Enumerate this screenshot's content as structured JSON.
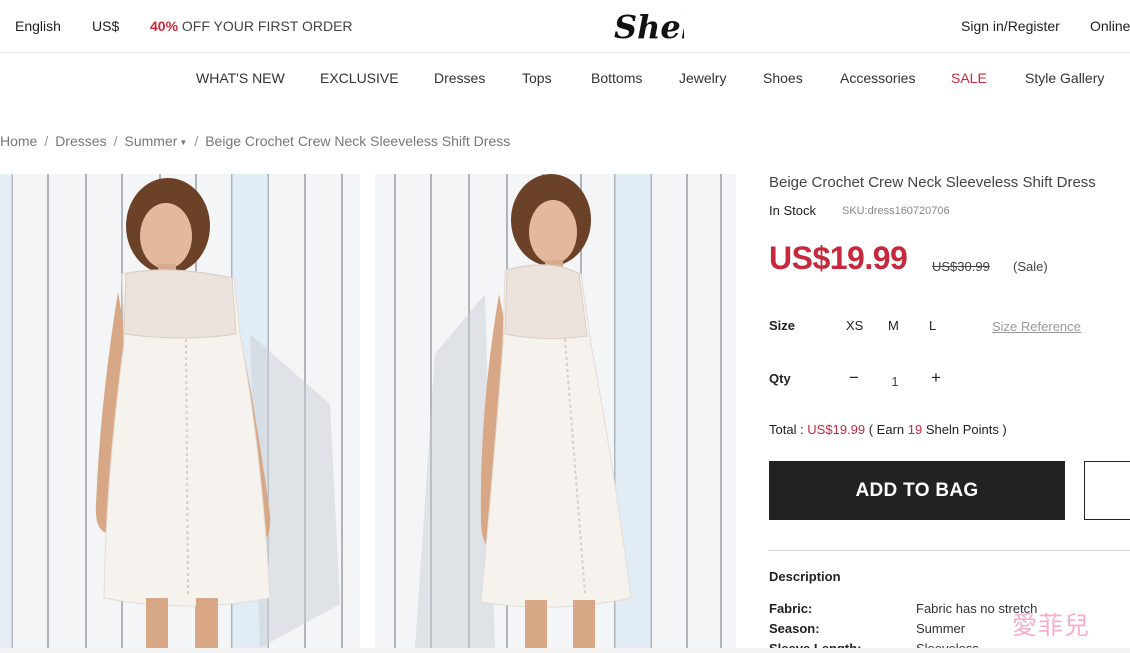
{
  "topbar": {
    "language": "English",
    "currency": "US$",
    "promo_pct": "40%",
    "promo_text": "OFF YOUR FIRST ORDER",
    "logo_text": "Sheln",
    "sign_in": "Sign in/Register",
    "online": "Online"
  },
  "nav": {
    "items": [
      "WHAT'S NEW",
      "EXCLUSIVE",
      "Dresses",
      "Tops",
      "Bottoms",
      "Jewelry",
      "Shoes",
      "Accessories",
      "SALE",
      "Style Gallery"
    ]
  },
  "breadcrumb": {
    "home": "Home",
    "dresses": "Dresses",
    "summer": "Summer",
    "current": "Beige Crochet Crew Neck Sleeveless Shift Dress"
  },
  "product": {
    "title": "Beige Crochet Crew Neck Sleeveless Shift Dress",
    "stock": "In Stock",
    "sku": "SKU:dress160720706",
    "price": "US$19.99",
    "old_price": "US$30.99",
    "sale_tag": "(Sale)",
    "size_label": "Size",
    "sizes": [
      "XS",
      "M",
      "L"
    ],
    "size_reference": "Size Reference",
    "qty_label": "Qty",
    "qty_minus": "−",
    "qty_value": "1",
    "qty_plus": "+",
    "total_prefix": "Total : ",
    "total_value": "US$19.99",
    "total_earn_open": " ( Earn ",
    "total_points": "19",
    "total_earn_close": " Sheln Points )",
    "add_to_bag": "ADD TO BAG",
    "description_heading": "Description",
    "attributes": [
      {
        "key": "Fabric:",
        "value": "Fabric has no stretch"
      },
      {
        "key": "Season:",
        "value": "Summer"
      },
      {
        "key": "Sleeve Length:",
        "value": "Sleeveless"
      }
    ]
  },
  "watermark": "愛菲兒",
  "colors": {
    "accent_red": "#c8283c",
    "button_dark": "#222222",
    "watermark_pink": "#f4a6c8"
  }
}
